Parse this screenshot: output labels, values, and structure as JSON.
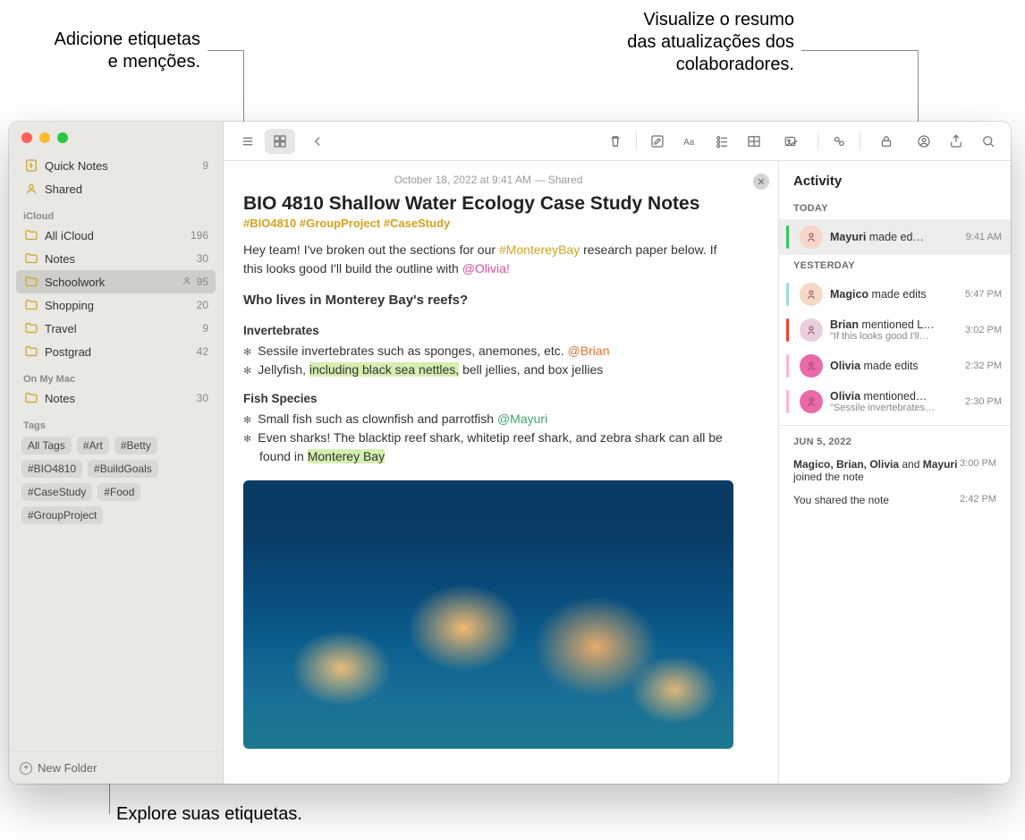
{
  "callouts": {
    "tags_mentions": "Adicione etiquetas\ne menções.",
    "activity_summary": "Visualize o resumo\ndas atualizações dos\ncolaboradores.",
    "explore_tags": "Explore suas etiquetas."
  },
  "sidebar": {
    "quick_notes": {
      "label": "Quick Notes",
      "count": "9"
    },
    "shared": {
      "label": "Shared"
    },
    "sections": {
      "icloud": "iCloud",
      "onmymac": "On My Mac",
      "tags": "Tags"
    },
    "icloud_items": [
      {
        "label": "All iCloud",
        "count": "196"
      },
      {
        "label": "Notes",
        "count": "30"
      },
      {
        "label": "Schoolwork",
        "count": "95",
        "shared": true,
        "selected": true
      },
      {
        "label": "Shopping",
        "count": "20"
      },
      {
        "label": "Travel",
        "count": "9"
      },
      {
        "label": "Postgrad",
        "count": "42"
      }
    ],
    "local_items": [
      {
        "label": "Notes",
        "count": "30"
      }
    ],
    "tags": [
      "All Tags",
      "#Art",
      "#Betty",
      "#BIO4810",
      "#BuildGoals",
      "#CaseStudy",
      "#Food",
      "#GroupProject"
    ],
    "new_folder": "New Folder"
  },
  "note": {
    "meta": "October 18, 2022 at 9:41 AM — Shared",
    "title": "BIO 4810 Shallow Water Ecology Case Study Notes",
    "tags": "#BIO4810 #GroupProject #CaseStudy",
    "intro_a": "Hey team! I've broken out the sections for our ",
    "intro_tag": "#MontereyBay",
    "intro_b": " research paper below. If this looks good I'll build the outline with ",
    "intro_mention": "@Olivia!",
    "h_reefs": "Who lives in Monterey Bay's reefs?",
    "h_invert": "Invertebrates",
    "invert1_a": "Sessile invertebrates such as sponges, anemones, etc. ",
    "invert1_mention": "@Brian",
    "invert2_a": "Jellyfish, ",
    "invert2_hl": "including black sea nettles,",
    "invert2_b": " bell jellies, and box jellies",
    "h_fish": "Fish Species",
    "fish1_a": "Small fish such as clownfish and parrotfish ",
    "fish1_mention": "@Mayuri",
    "fish2_a": "Even sharks! The blacktip reef shark, whitetip reef shark, and zebra shark can all be found in ",
    "fish2_hl": "Monterey Bay"
  },
  "activity": {
    "title": "Activity",
    "today": "TODAY",
    "yesterday": "YESTERDAY",
    "date3": "JUN 5, 2022",
    "items_today": [
      {
        "who": "Mayuri",
        "rest": " made ed…",
        "time": "9:41 AM",
        "bar": "#34c759",
        "avatar_bg": "#f5d6c8"
      }
    ],
    "items_yesterday": [
      {
        "who": "Magico",
        "rest": " made edits",
        "time": "5:47 PM",
        "bar": "#9fd9ea",
        "avatar_bg": "#f3d9c6"
      },
      {
        "who": "Brian",
        "rest": " mentioned L…",
        "sub": "\"If this looks good I'll…",
        "time": "3:02 PM",
        "bar": "#ff3b30",
        "avatar_bg": "#e9cfe0"
      },
      {
        "who": "Olivia",
        "rest": " made edits",
        "time": "2:32 PM",
        "bar": "#ffb5c9",
        "avatar_bg": "#e96aa8"
      },
      {
        "who": "Olivia",
        "rest": " mentioned…",
        "sub": "\"Sessile invertebrates…",
        "time": "2:30 PM",
        "bar": "#ffb5c9",
        "avatar_bg": "#e96aa8"
      }
    ],
    "joined_a": "Magico, Brian, Olivia",
    "joined_b": " and ",
    "joined_c": "Mayuri",
    "joined_d": " joined the note",
    "joined_time": "3:00 PM",
    "shared_text": "You shared the note",
    "shared_time": "2:42 PM"
  }
}
